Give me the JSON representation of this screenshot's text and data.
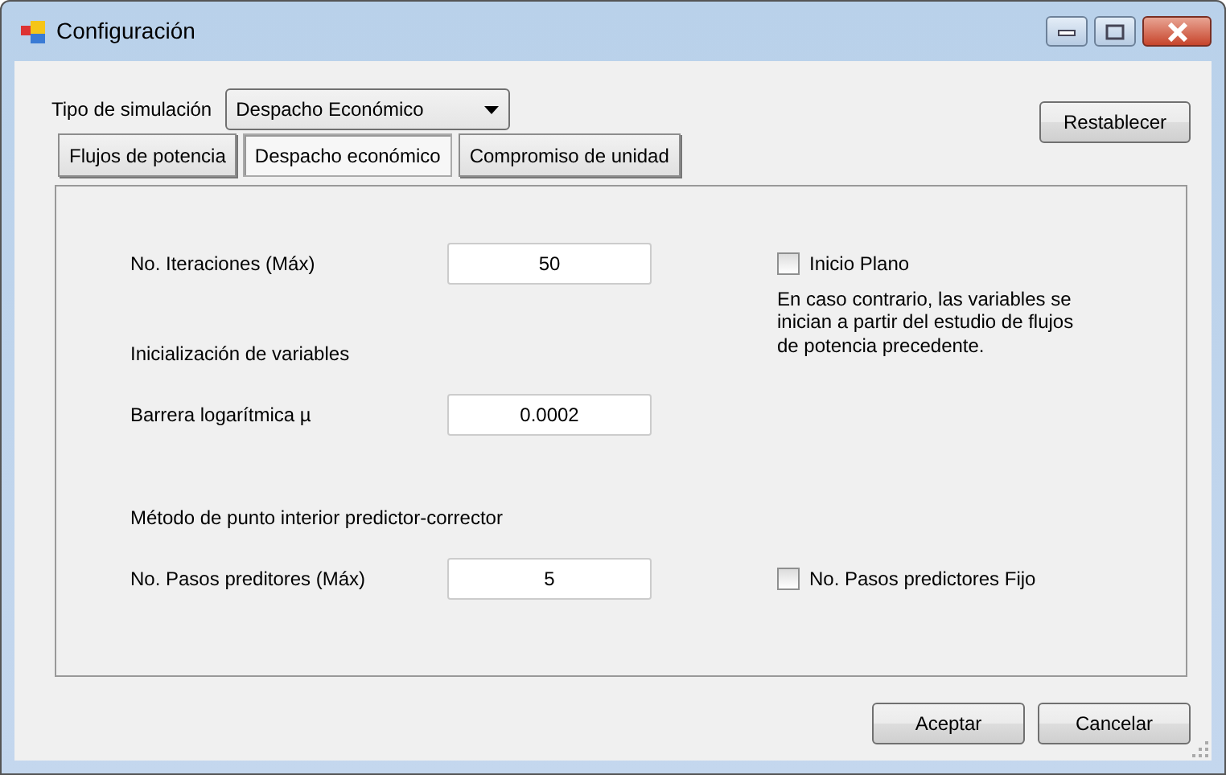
{
  "window": {
    "title": "Configuración"
  },
  "simulation_type": {
    "label": "Tipo de simulación",
    "value": "Despacho Económico"
  },
  "reset_button": "Restablecer",
  "tabs": [
    {
      "label": "Flujos de potencia",
      "selected": false
    },
    {
      "label": "Despacho económico",
      "selected": true
    },
    {
      "label": "Compromiso de unidad",
      "selected": false
    }
  ],
  "rows": [
    {
      "kind": "field",
      "label": "No. Iteraciones (Máx)",
      "value": "50",
      "checkbox": {
        "label": "Inicio Plano",
        "checked": false,
        "note": "En caso contrario, las variables se inician a partir del estudio de flujos de potencia precedente."
      }
    },
    {
      "kind": "heading",
      "label": "Inicialización de variables"
    },
    {
      "kind": "field",
      "label": "Barrera logarítmica µ",
      "value": "0.0002"
    },
    {
      "kind": "heading",
      "label": "Método de punto interior predictor-corrector"
    },
    {
      "kind": "field",
      "label": "No. Pasos preditores (Máx)",
      "value": "5",
      "checkbox": {
        "label": "No. Pasos predictores Fijo",
        "checked": false
      }
    }
  ],
  "buttons": [
    "Aceptar",
    "Cancelar"
  ]
}
